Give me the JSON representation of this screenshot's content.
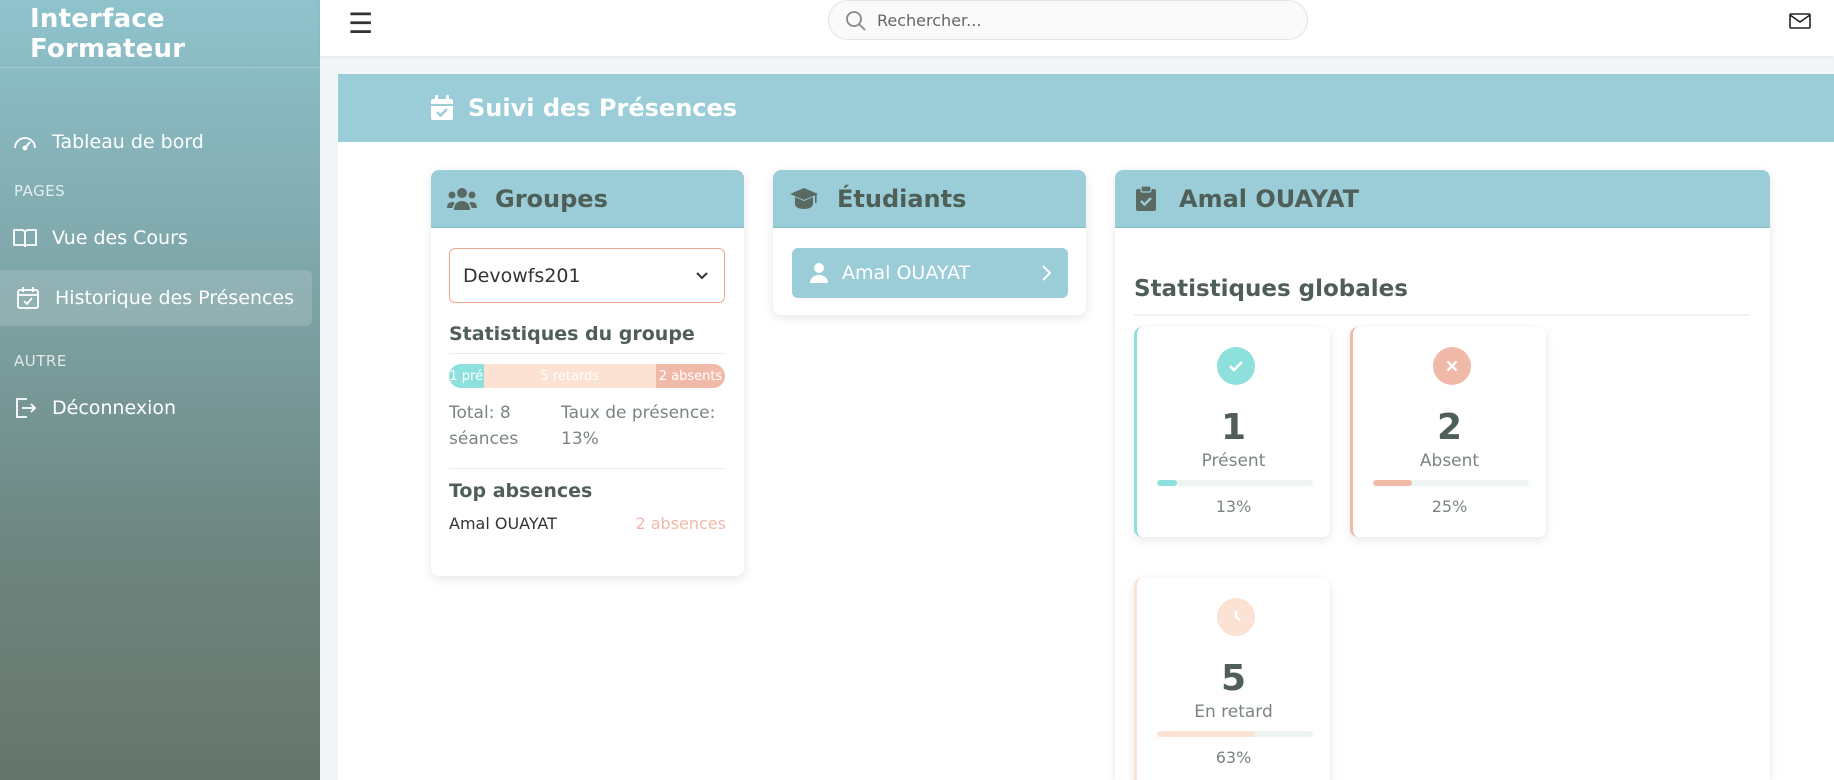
{
  "sidebar": {
    "brand": "Interface Formateur",
    "dashboard": "Tableau de bord",
    "section_pages": "PAGES",
    "courses": "Vue des Cours",
    "attendance_history": "Historique des Présences",
    "section_other": "AUTRE",
    "logout": "Déconnexion"
  },
  "topbar": {
    "menu_icon": "☰",
    "search_placeholder": "Rechercher..."
  },
  "banner": {
    "title": "Suivi des Présences"
  },
  "groups": {
    "title": "Groupes",
    "selected_group": "Devowfs201",
    "stats_title": "Statistiques du groupe",
    "bar": [
      {
        "label": "1 pré",
        "fraction": 0.125,
        "color": "#8ee0dc"
      },
      {
        "label": "5 retards",
        "fraction": 0.625,
        "color": "#fbe2d2"
      },
      {
        "label": "2 absents",
        "fraction": 0.25,
        "color": "#f0b9a8"
      }
    ],
    "total": "Total: 8 séances",
    "rate": "Taux de présence: 13%",
    "top_title": "Top absences",
    "top_name": "Amal OUAYAT",
    "top_count": "2 absences"
  },
  "students": {
    "title": "Étudiants",
    "item": "Amal OUAYAT"
  },
  "detail": {
    "title": "Amal OUAYAT",
    "global_title": "Statistiques globales",
    "present": {
      "value": "1",
      "label": "Présent",
      "pct": "13%",
      "fraction": 0.13,
      "color": "#8ee0dc"
    },
    "absent": {
      "value": "2",
      "label": "Absent",
      "pct": "25%",
      "fraction": 0.25,
      "color": "#f0b9a8"
    },
    "late": {
      "value": "5",
      "label": "En retard",
      "pct": "63%",
      "fraction": 0.63,
      "color": "#fbe2d2"
    }
  }
}
